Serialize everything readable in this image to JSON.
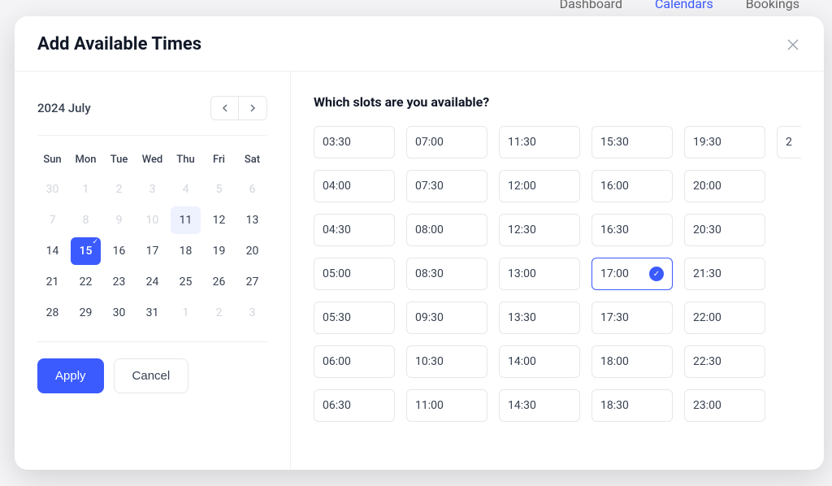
{
  "nav": {
    "dashboard": "Dashboard",
    "calendars": "Calendars",
    "bookings": "Bookings"
  },
  "modal": {
    "title": "Add Available Times"
  },
  "calendar": {
    "month_label": "2024 July",
    "dow": [
      "Sun",
      "Mon",
      "Tue",
      "Wed",
      "Thu",
      "Fri",
      "Sat"
    ],
    "days": [
      {
        "n": "30",
        "muted": true
      },
      {
        "n": "1",
        "muted": true
      },
      {
        "n": "2",
        "muted": true
      },
      {
        "n": "3",
        "muted": true
      },
      {
        "n": "4",
        "muted": true
      },
      {
        "n": "5",
        "muted": true
      },
      {
        "n": "6",
        "muted": true
      },
      {
        "n": "7",
        "muted": true
      },
      {
        "n": "8",
        "muted": true
      },
      {
        "n": "9",
        "muted": true
      },
      {
        "n": "10",
        "muted": true
      },
      {
        "n": "11",
        "hl": true
      },
      {
        "n": "12"
      },
      {
        "n": "13"
      },
      {
        "n": "14"
      },
      {
        "n": "15",
        "selected": true
      },
      {
        "n": "16"
      },
      {
        "n": "17"
      },
      {
        "n": "18"
      },
      {
        "n": "19"
      },
      {
        "n": "20"
      },
      {
        "n": "21"
      },
      {
        "n": "22"
      },
      {
        "n": "23"
      },
      {
        "n": "24"
      },
      {
        "n": "25"
      },
      {
        "n": "26"
      },
      {
        "n": "27"
      },
      {
        "n": "28"
      },
      {
        "n": "29"
      },
      {
        "n": "30"
      },
      {
        "n": "31"
      },
      {
        "n": "1",
        "muted": true
      },
      {
        "n": "2",
        "muted": true
      },
      {
        "n": "3",
        "muted": true
      }
    ],
    "apply_label": "Apply",
    "cancel_label": "Cancel"
  },
  "slots": {
    "title": "Which slots are you available?",
    "columns": [
      [
        "03:30",
        "04:00",
        "04:30",
        "05:00",
        "05:30",
        "06:00",
        "06:30"
      ],
      [
        "07:00",
        "07:30",
        "08:00",
        "08:30",
        "09:30",
        "10:30",
        "11:00"
      ],
      [
        "11:30",
        "12:00",
        "12:30",
        "13:00",
        "13:30",
        "14:00",
        "14:30"
      ],
      [
        "15:30",
        "16:00",
        "16:30",
        "17:00",
        "17:30",
        "18:00",
        "18:30"
      ],
      [
        "19:30",
        "20:00",
        "20:30",
        "21:30",
        "22:00",
        "22:30",
        "23:00"
      ]
    ],
    "selected": "17:00",
    "overflow": "2"
  }
}
